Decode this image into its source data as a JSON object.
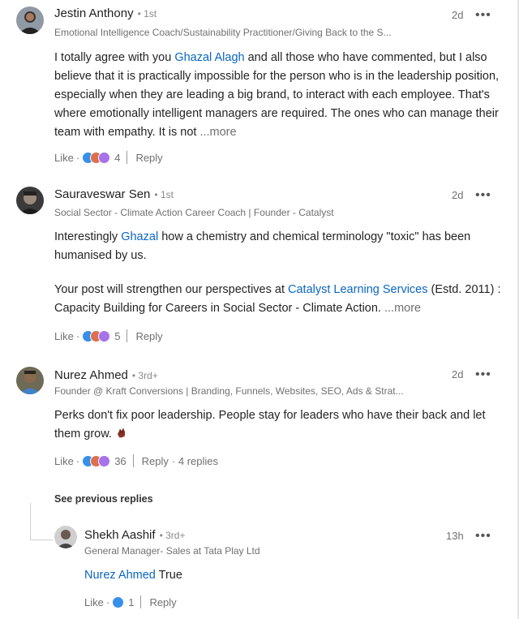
{
  "comments": [
    {
      "name": "Jestin Anthony",
      "degree": "• 1st",
      "headline": "Emotional Intelligence Coach/Sustainability Practitioner/Giving Back to the S...",
      "time": "2d",
      "menu": "•••",
      "body": {
        "pre": "I totally agree with you ",
        "mention": "Ghazal Alagh",
        "post": " and all those who have commented, but I also believe that it is practically impossible for the person who is in the leadership position, especially when they are leading a big brand, to interact with each employee. That's where emotionally intelligent managers are required. The ones who can manage their team with empathy. It is not  ",
        "more": "...more"
      },
      "like_label": "Like",
      "dot": "·",
      "reactions_count": "4",
      "reply_label": "Reply"
    },
    {
      "name": "Sauraveswar Sen",
      "degree": "• 1st",
      "headline": "Social Sector - Climate Action Career Coach | Founder - Catalyst",
      "time": "2d",
      "menu": "•••",
      "body": {
        "p1_pre": "Interestingly ",
        "p1_mention": "Ghazal",
        "p1_post": " how a chemistry and chemical terminology \"toxic\" has been humanised by us.",
        "p2_pre": "Your post will strengthen our perspectives at ",
        "p2_mention": "Catalyst Learning Services",
        "p2_post": " (Estd. 2011) : Capacity Building for Careers in Social Sector - Climate Action.  ",
        "more": "...more"
      },
      "like_label": "Like",
      "dot": "·",
      "reactions_count": "5",
      "reply_label": "Reply"
    },
    {
      "name": "Nurez Ahmed",
      "degree": "• 3rd+",
      "headline": "Founder @ Kraft Conversions | Branding, Funnels, Websites, SEO, Ads & Strat...",
      "time": "2d",
      "menu": "•••",
      "body": {
        "text": "Perks don't fix poor leadership. People stay for leaders who have their back and let them grow. "
      },
      "like_label": "Like",
      "dot": "·",
      "reactions_count": "36",
      "reply_label": "Reply",
      "replies_count": "· 4 replies"
    }
  ],
  "see_previous": "See previous replies",
  "reply": {
    "name": "Shekh Aashif",
    "degree": "• 3rd+",
    "headline": "General Manager- Sales at Tata Play Ltd",
    "time": "13h",
    "menu": "•••",
    "mention": "Nurez Ahmed",
    "text": " True",
    "like_label": "Like",
    "dot": "·",
    "reactions_count": "1",
    "reply_label": "Reply"
  },
  "colors": {
    "link": "#0a66c2",
    "like": "#378fe9",
    "love": "#df704d",
    "support": "#a872e8"
  }
}
